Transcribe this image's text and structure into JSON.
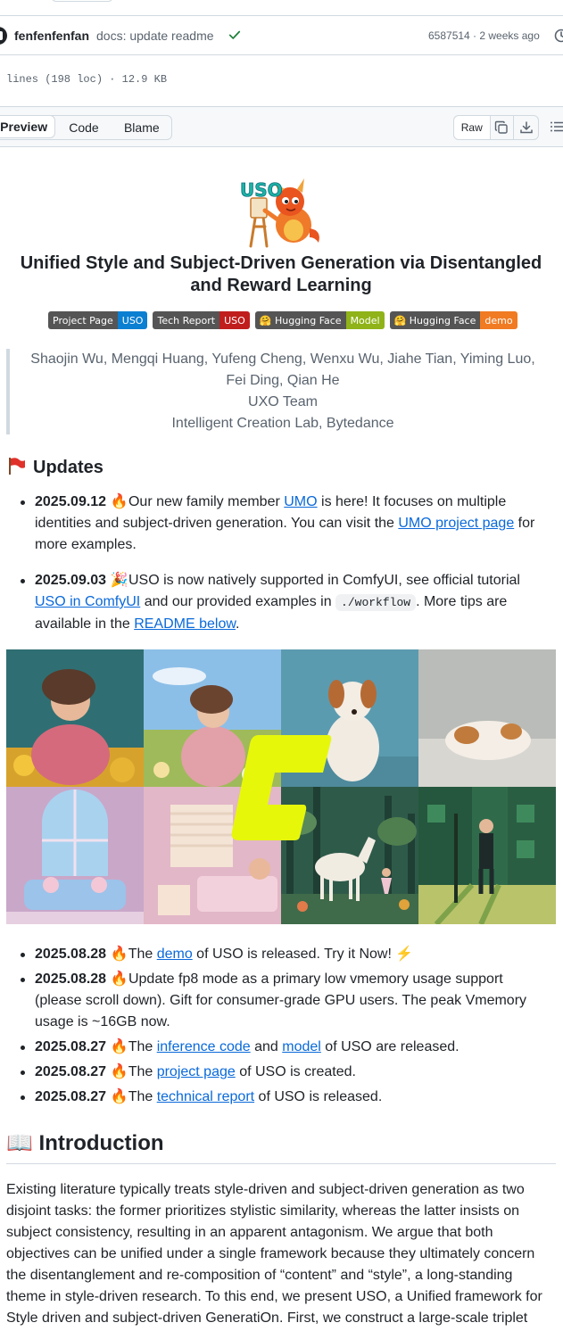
{
  "commit": {
    "author": "fenfenfenfan",
    "message": "docs: update readme",
    "meta": "6587514 · 2 weeks ago"
  },
  "file_info": "lines (198 loc) · 12.9 KB",
  "toolbar": {
    "tabs": [
      "Preview",
      "Code",
      "Blame"
    ],
    "raw_label": "Raw"
  },
  "readme": {
    "logo_text": "USO",
    "title": "Unified Style and Subject-Driven Generation via Disentangled and Reward Learning",
    "badges": [
      {
        "label": "Project Page",
        "value": "USO",
        "color": "#0b7fd1"
      },
      {
        "label": "Tech Report",
        "value": "USO",
        "color": "#c01d1d"
      },
      {
        "label": "🤗 Hugging Face",
        "value": "Model",
        "color": "#8fb318"
      },
      {
        "label": "🤗 Hugging Face",
        "value": "demo",
        "color": "#f07b23"
      }
    ],
    "authors_line1": "Shaojin Wu, Mengqi Huang, Yufeng Cheng, Wenxu Wu, Jiahe Tian, Yiming Luo,",
    "authors_line2": "Fei Ding, Qian He",
    "team": "UXO Team",
    "lab": "Intelligent Creation Lab, Bytedance",
    "updates_title": "Updates",
    "u1": {
      "date": "2025.09.12",
      "t1": " Our new family member ",
      "l1": "UMO",
      "t2": " is here! It focuses on multiple identities and subject-driven generation. You can visit the ",
      "l2": "UMO project page",
      "t3": " for more examples."
    },
    "u2": {
      "date": "2025.09.03",
      "t1": " USO is now natively supported in ComfyUI, see official tutorial ",
      "l1": "USO in ComfyUI",
      "t2": " and our provided examples in ",
      "code": "./workflow",
      "t3": ". More tips are available in the ",
      "l2": "README below",
      "t4": "."
    },
    "u3": {
      "date": "2025.08.28",
      "t1": " The ",
      "l1": "demo",
      "t2": " of USO is released. Try it Now! ⚡"
    },
    "u4": {
      "date": "2025.08.28",
      "t1": " Update fp8 mode as a primary low vmemory usage support (please scroll down). Gift for consumer-grade GPU users. The peak Vmemory usage is ~16GB now."
    },
    "u5": {
      "date": "2025.08.27",
      "t1": " The ",
      "l1": "inference code",
      "t2": " and ",
      "l2": "model",
      "t3": " of USO are released."
    },
    "u6": {
      "date": "2025.08.27",
      "t1": " The ",
      "l1": "project page",
      "t2": " of USO is created."
    },
    "u7": {
      "date": "2025.08.27",
      "t1": " The ",
      "l1": "technical report",
      "t2": " of USO is released."
    },
    "intro_title": "📖 Introduction",
    "intro_text": "Existing literature typically treats style-driven and subject-driven generation as two disjoint tasks: the former prioritizes stylistic similarity, whereas the latter insists on subject consistency, resulting in an apparent antagonism. We argue that both objectives can be unified under a single framework because they ultimately concern the disentanglement and re-composition of “content” and “style”, a long-standing theme in style-driven research. To this end, we present USO, a Unified framework for Style driven and subject-driven GeneratiOn. First, we construct a large-scale triplet"
  },
  "icons": {
    "check": "check-icon",
    "history": "history-icon",
    "copy": "copy-icon",
    "download": "download-icon",
    "list": "list-icon",
    "flag": "flag-icon",
    "fire": "🔥",
    "party": "🎉"
  },
  "colors": {
    "link": "#0969da",
    "check": "#1a7f37",
    "c_mark": "#e6f70a"
  }
}
